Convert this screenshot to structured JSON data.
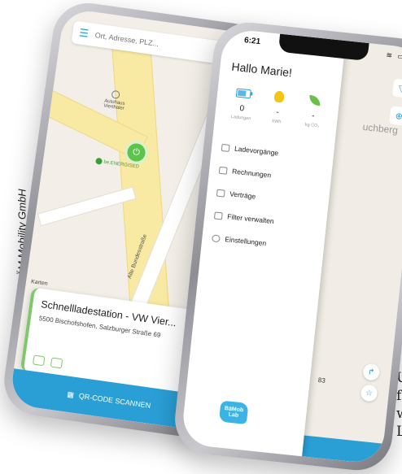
{
  "credit": "Foto: BÄM Mobility GmbH",
  "side_text": [
    "U",
    "f",
    "w",
    "L"
  ],
  "back_phone": {
    "search_placeholder": "Ort, Adresse, PLZ...",
    "street_label": "Alte Bundesstraße",
    "poi_label": "Autohaus Vierthaler",
    "station_label": "be.ENERGISED",
    "karten_label": "Karten",
    "card": {
      "title": "Schnellladestation - VW Vier...",
      "address": "5500 Bischofshofen, Salzburger Straße 69"
    },
    "qr_label": "QR-CODE SCANNEN"
  },
  "front_phone": {
    "time": "6:21",
    "greeting": "Hallo Marie!",
    "stats": [
      {
        "icon": "battery-icon",
        "value": "0",
        "label": "Ladungen"
      },
      {
        "icon": "bulb-icon",
        "value": "-",
        "label": "kWh"
      },
      {
        "icon": "leaf-icon",
        "value": "-",
        "label": "kg CO₂"
      }
    ],
    "menu": [
      {
        "icon": "charging-icon",
        "label": "Ladevorgänge"
      },
      {
        "icon": "invoice-icon",
        "label": "Rechnungen"
      },
      {
        "icon": "contract-icon",
        "label": "Verträge"
      },
      {
        "icon": "filter-icon",
        "label": "Filter verwalten"
      },
      {
        "icon": "settings-icon",
        "label": "Einstellungen"
      }
    ],
    "behind_place": "uchberg",
    "behind_number": "83",
    "logo_text": "BäMob Lab"
  }
}
